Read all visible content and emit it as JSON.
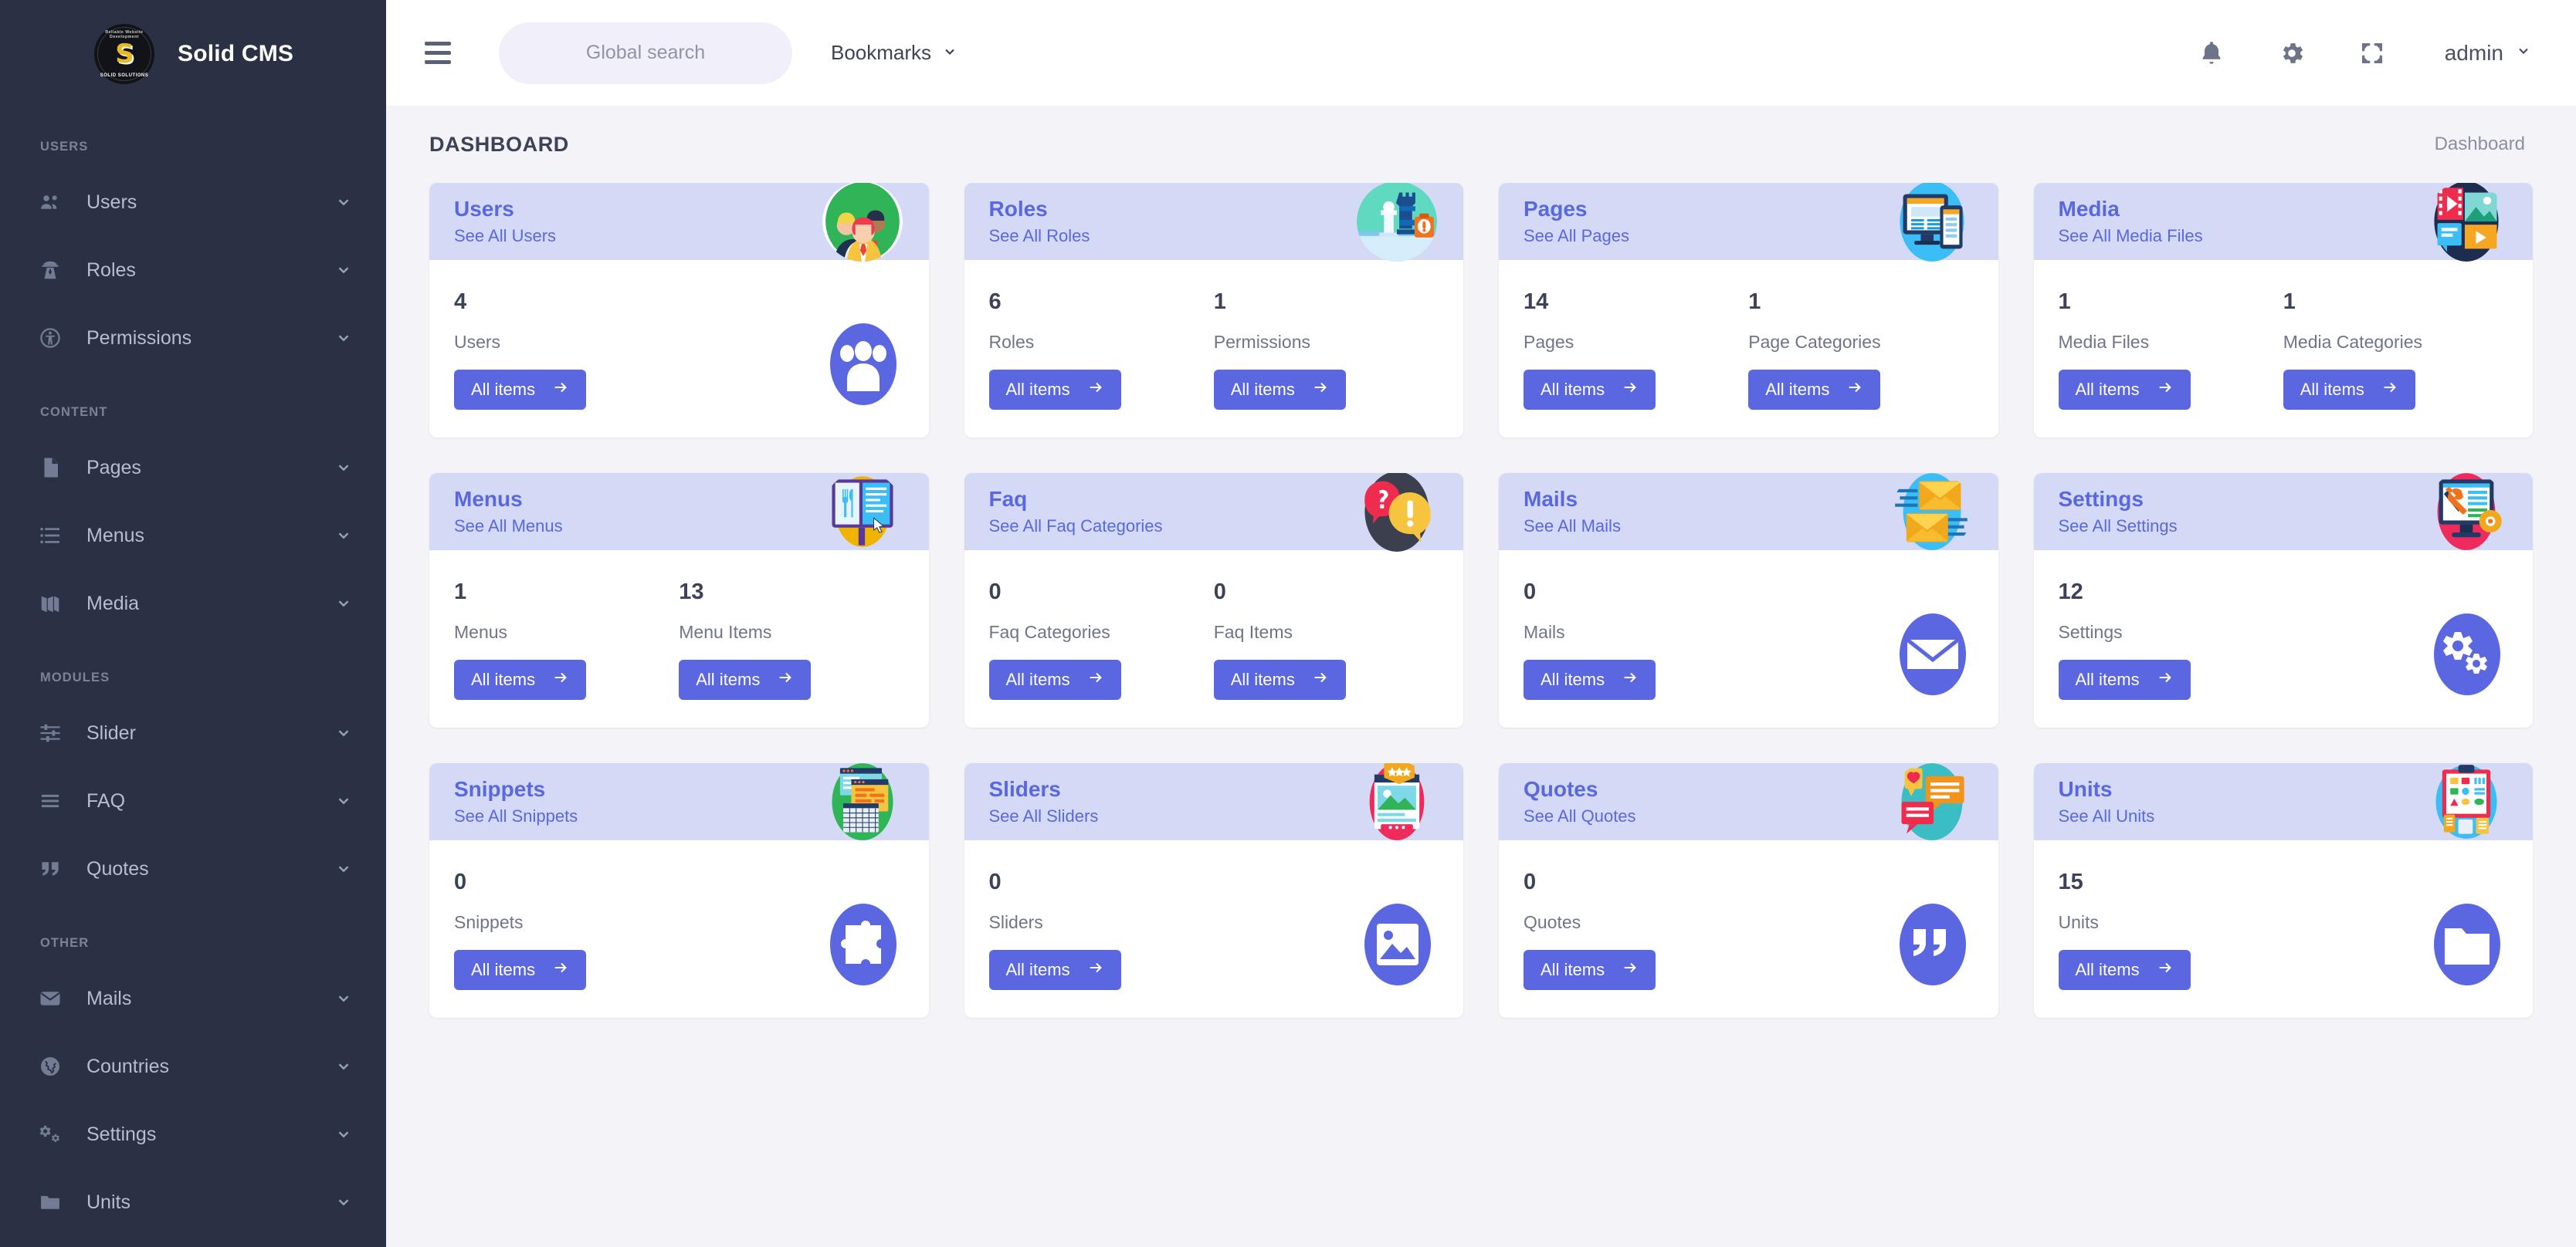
{
  "brand": {
    "name": "Solid CMS",
    "logo_mark": "S",
    "logo_top_text": "Reliable Website Development",
    "logo_bottom_text": "SOLID SOLUTIONS",
    "logo_icon": "solid-solutions-badge-icon"
  },
  "colors": {
    "sidebar_bg": "#2b3144",
    "accent": "#5a67e0",
    "card_head_bg": "#d4daf6",
    "content_bg": "#f4f4f8",
    "title_text": "#3c4257"
  },
  "sidebar": {
    "sections": [
      {
        "label": "USERS",
        "items": [
          {
            "label": "Users",
            "icon": "users-group-icon"
          },
          {
            "label": "Roles",
            "icon": "detective-icon"
          },
          {
            "label": "Permissions",
            "icon": "accessibility-icon"
          }
        ]
      },
      {
        "label": "CONTENT",
        "items": [
          {
            "label": "Pages",
            "icon": "document-icon"
          },
          {
            "label": "Menus",
            "icon": "list-icon"
          },
          {
            "label": "Media",
            "icon": "media-book-icon"
          }
        ]
      },
      {
        "label": "MODULES",
        "items": [
          {
            "label": "Slider",
            "icon": "sliders-icon"
          },
          {
            "label": "FAQ",
            "icon": "lines-icon"
          },
          {
            "label": "Quotes",
            "icon": "quote-icon"
          }
        ]
      },
      {
        "label": "OTHER",
        "items": [
          {
            "label": "Mails",
            "icon": "envelope-icon"
          },
          {
            "label": "Countries",
            "icon": "globe-icon"
          },
          {
            "label": "Settings",
            "icon": "gears-icon"
          },
          {
            "label": "Units",
            "icon": "folder-icon"
          }
        ]
      }
    ]
  },
  "topbar": {
    "menu_toggle_icon": "hamburger-icon",
    "search": {
      "value": "",
      "placeholder": "Global search",
      "icon": "search-icon"
    },
    "bookmarks_label": "Bookmarks",
    "bookmarks_icon": "chevron-down-icon",
    "notifications_icon": "bell-icon",
    "settings_icon": "gear-icon",
    "fullscreen_icon": "fullscreen-icon",
    "user_label": "admin",
    "user_chevron_icon": "chevron-down-icon"
  },
  "page": {
    "title": "DASHBOARD",
    "breadcrumb": "Dashboard"
  },
  "cards": [
    {
      "title": "Users",
      "link": "See All Users",
      "illustration": "people-team-illustration",
      "deco_icon": "users-group-icon",
      "stats": [
        {
          "count": "4",
          "label": "Users",
          "button": "All items"
        }
      ]
    },
    {
      "title": "Roles",
      "link": "See All Roles",
      "illustration": "chess-rook-illustration",
      "deco_icon": "",
      "stats": [
        {
          "count": "6",
          "label": "Roles",
          "button": "All items"
        },
        {
          "count": "1",
          "label": "Permissions",
          "button": "All items"
        }
      ]
    },
    {
      "title": "Pages",
      "link": "See All Pages",
      "illustration": "monitor-page-illustration",
      "deco_icon": "",
      "stats": [
        {
          "count": "14",
          "label": "Pages",
          "button": "All items"
        },
        {
          "count": "1",
          "label": "Page Categories",
          "button": "All items"
        }
      ]
    },
    {
      "title": "Media",
      "link": "See All Media Files",
      "illustration": "media-collage-illustration",
      "deco_icon": "",
      "stats": [
        {
          "count": "1",
          "label": "Media Files",
          "button": "All items"
        },
        {
          "count": "1",
          "label": "Media Categories",
          "button": "All items"
        }
      ]
    },
    {
      "title": "Menus",
      "link": "See All Menus",
      "illustration": "restaurant-menu-illustration",
      "deco_icon": "",
      "stats": [
        {
          "count": "1",
          "label": "Menus",
          "button": "All items"
        },
        {
          "count": "13",
          "label": "Menu Items",
          "button": "All items"
        }
      ]
    },
    {
      "title": "Faq",
      "link": "See All Faq Categories",
      "illustration": "question-bubble-illustration",
      "deco_icon": "",
      "stats": [
        {
          "count": "0",
          "label": "Faq Categories",
          "button": "All items"
        },
        {
          "count": "0",
          "label": "Faq Items",
          "button": "All items"
        }
      ]
    },
    {
      "title": "Mails",
      "link": "See All Mails",
      "illustration": "envelopes-illustration",
      "deco_icon": "envelope-icon",
      "stats": [
        {
          "count": "0",
          "label": "Mails",
          "button": "All items"
        }
      ]
    },
    {
      "title": "Settings",
      "link": "See All Settings",
      "illustration": "monitor-tools-illustration",
      "deco_icon": "gears-icon",
      "stats": [
        {
          "count": "12",
          "label": "Settings",
          "button": "All items"
        }
      ]
    },
    {
      "title": "Snippets",
      "link": "See All Snippets",
      "illustration": "code-windows-illustration",
      "deco_icon": "puzzle-icon",
      "stats": [
        {
          "count": "0",
          "label": "Snippets",
          "button": "All items"
        }
      ]
    },
    {
      "title": "Sliders",
      "link": "See All Sliders",
      "illustration": "slider-stars-illustration",
      "deco_icon": "image-icon",
      "stats": [
        {
          "count": "0",
          "label": "Sliders",
          "button": "All items"
        }
      ]
    },
    {
      "title": "Quotes",
      "link": "See All Quotes",
      "illustration": "speech-bubbles-illustration",
      "deco_icon": "quote-icon",
      "stats": [
        {
          "count": "0",
          "label": "Quotes",
          "button": "All items"
        }
      ]
    },
    {
      "title": "Units",
      "link": "See All Units",
      "illustration": "clipboard-shapes-illustration",
      "deco_icon": "folder-icon",
      "stats": [
        {
          "count": "15",
          "label": "Units",
          "button": "All items"
        }
      ]
    }
  ]
}
